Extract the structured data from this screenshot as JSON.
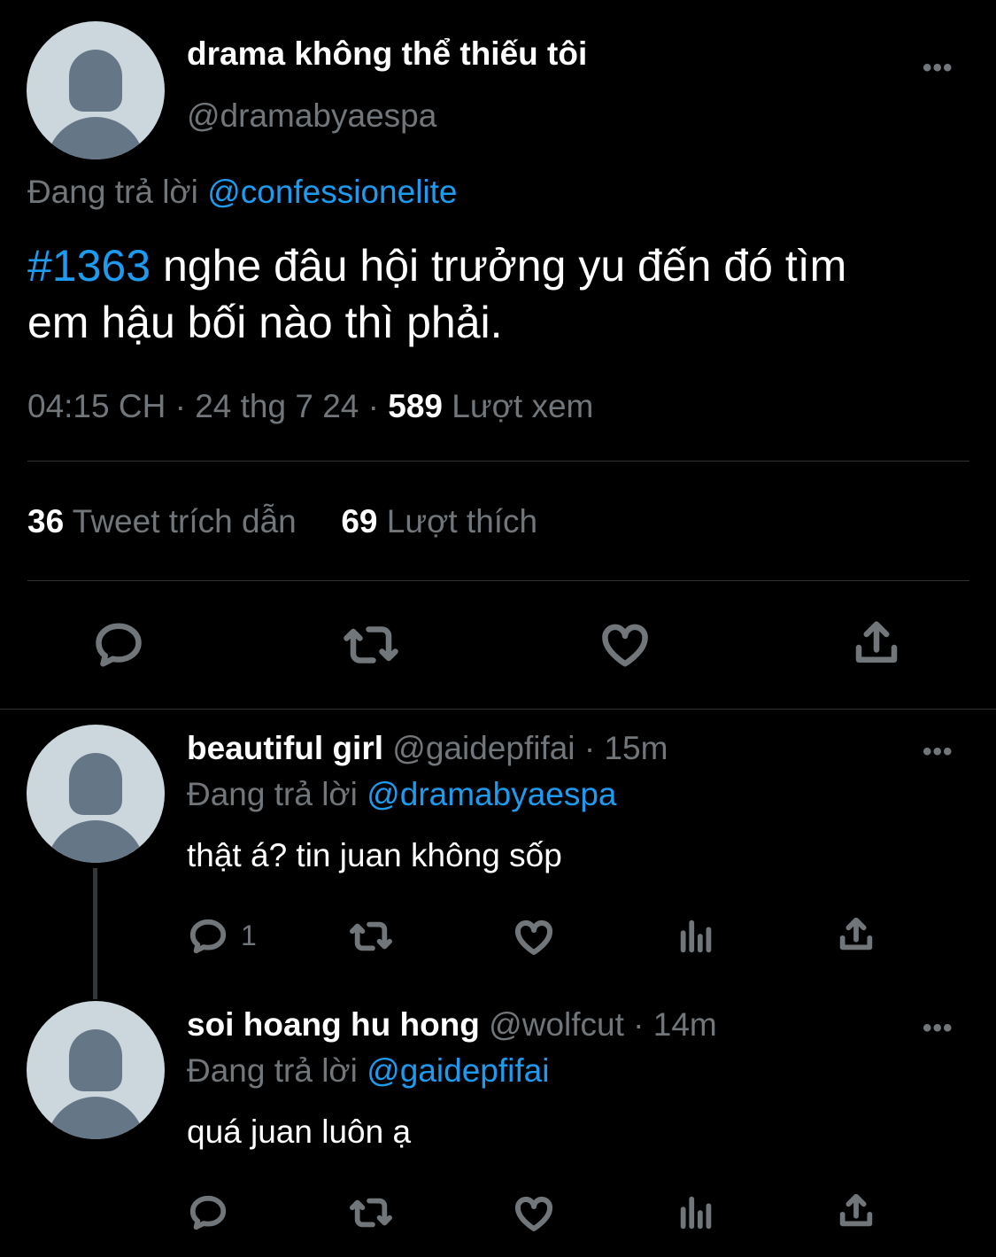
{
  "main_tweet": {
    "display_name": "drama không thể thiếu tôi",
    "handle": "@dramabyaespa",
    "replying_to_label": "Đang trả lời",
    "replying_to_handle": "@confessionelite",
    "hashtag": "#1363",
    "text_line1": "nghe đâu hội trưởng yu đến đó tìm",
    "text_line2": "em hậu bối nào thì phải.",
    "time": "04:15 CH",
    "date": "24 thg 7 24",
    "dot": "·",
    "views_count": "589",
    "views_label": "Lượt xem",
    "quotes_count": "36",
    "quotes_label": "Tweet trích dẫn",
    "likes_count": "69",
    "likes_label": "Lượt thích",
    "more": "•••",
    "actions": [
      "reply-icon",
      "retweet-icon",
      "like-icon",
      "share-icon"
    ]
  },
  "replies": [
    {
      "display_name": "beautiful girl",
      "handle": "@gaidepfifai",
      "time": "· 15m",
      "replying_to_label": "Đang trả lời",
      "replying_to_handle": "@dramabyaespa",
      "text": "thật á? tin juan không sốp",
      "reply_count": "1",
      "more": "•••"
    },
    {
      "display_name": "soi hoang hu hong",
      "handle": "@wolfcut",
      "time": "· 14m",
      "replying_to_label": "Đang trả lời",
      "replying_to_handle": "@gaidepfifai",
      "text": "quá juan luôn ạ",
      "reply_count": "",
      "more": "•••"
    }
  ],
  "colors": {
    "background": "#000000",
    "text": "#e7e9ea",
    "secondary": "#71767b",
    "accent": "#1d9bf0",
    "divider": "#2f3336"
  }
}
